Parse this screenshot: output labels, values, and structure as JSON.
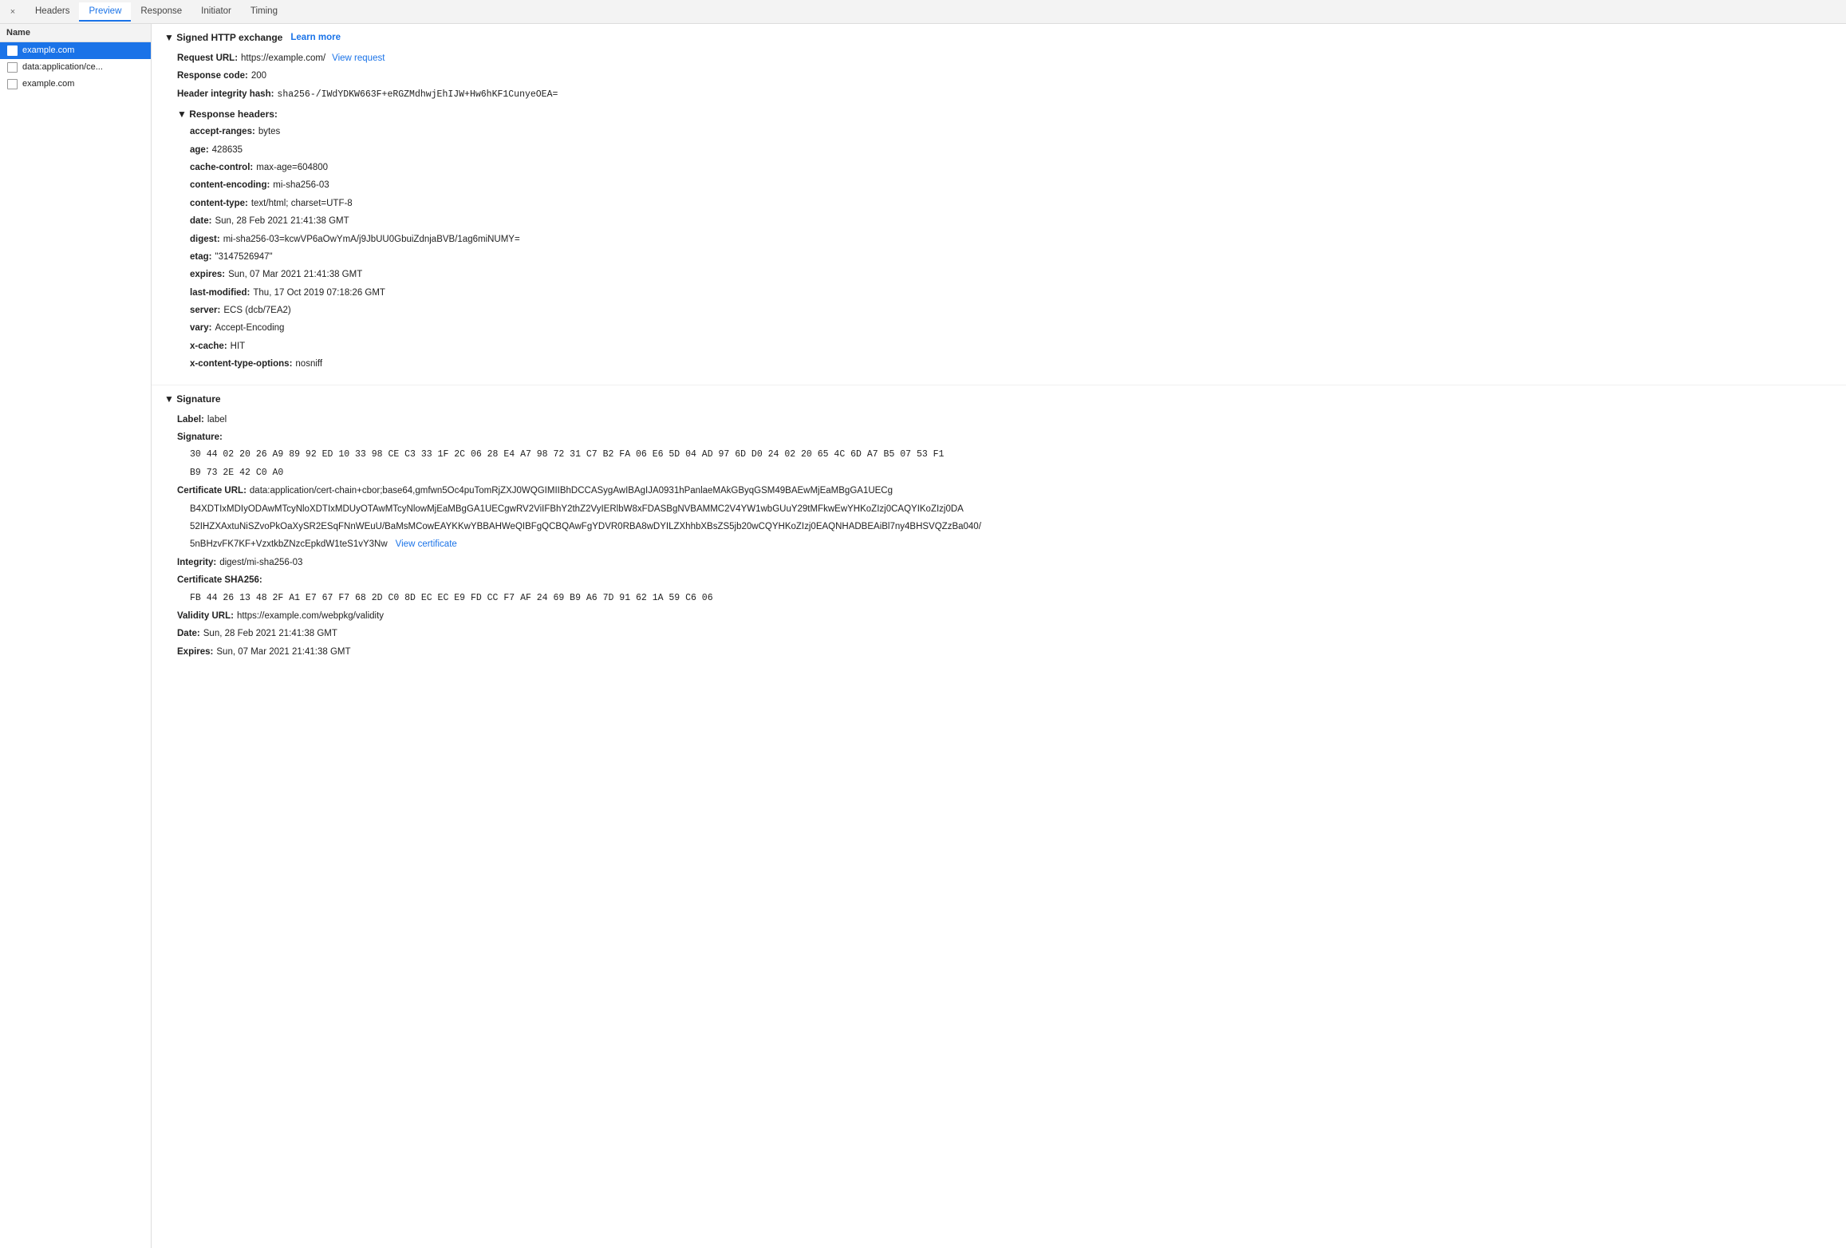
{
  "tabs": {
    "close_icon": "×",
    "items": [
      {
        "label": "Headers",
        "active": false
      },
      {
        "label": "Preview",
        "active": true
      },
      {
        "label": "Response",
        "active": false
      },
      {
        "label": "Initiator",
        "active": false
      },
      {
        "label": "Timing",
        "active": false
      }
    ]
  },
  "sidebar": {
    "header": "Name",
    "items": [
      {
        "label": "example.com",
        "selected": true
      },
      {
        "label": "data:application/ce...",
        "selected": false
      },
      {
        "label": "example.com",
        "selected": false
      }
    ]
  },
  "signed_exchange": {
    "section_title": "▼ Signed HTTP exchange",
    "learn_more": "Learn more",
    "request_url_label": "Request URL:",
    "request_url_value": "https://example.com/",
    "view_request": "View request",
    "response_code_label": "Response code:",
    "response_code_value": "200",
    "header_integrity_label": "Header integrity hash:",
    "header_integrity_value": "sha256-/IWdYDKW663F+eRGZMdhwjEhIJW+Hw6hKF1CunyeOEA=",
    "response_headers_title": "▼ Response headers:",
    "response_headers": [
      {
        "key": "accept-ranges:",
        "value": "bytes"
      },
      {
        "key": "age:",
        "value": "428635"
      },
      {
        "key": "cache-control:",
        "value": "max-age=604800"
      },
      {
        "key": "content-encoding:",
        "value": "mi-sha256-03"
      },
      {
        "key": "content-type:",
        "value": "text/html; charset=UTF-8"
      },
      {
        "key": "date:",
        "value": "Sun, 28 Feb 2021 21:41:38 GMT"
      },
      {
        "key": "digest:",
        "value": "mi-sha256-03=kcwVP6aOwYmA/j9JbUU0GbuiZdnjaBVB/1ag6miNUMY="
      },
      {
        "key": "etag:",
        "value": "\"3147526947\""
      },
      {
        "key": "expires:",
        "value": "Sun, 07 Mar 2021 21:41:38 GMT"
      },
      {
        "key": "last-modified:",
        "value": "Thu, 17 Oct 2019 07:18:26 GMT"
      },
      {
        "key": "server:",
        "value": "ECS (dcb/7EA2)"
      },
      {
        "key": "vary:",
        "value": "Accept-Encoding"
      },
      {
        "key": "x-cache:",
        "value": "HIT"
      },
      {
        "key": "x-content-type-options:",
        "value": "nosniff"
      }
    ]
  },
  "signature": {
    "section_title": "▼ Signature",
    "label_key": "Label:",
    "label_value": "label",
    "signature_key": "Signature:",
    "signature_line1": "30 44 02 20 26 A9 89 92 ED 10 33 98 CE C3 33 1F 2C 06 28 E4 A7 98 72 31 C7 B2 FA 06 E6 5D 04 AD 97 6D D0 24 02 20 65 4C 6D A7 B5 07 53 F1",
    "signature_line2": "B9 73 2E 42 C0 A0",
    "cert_url_key": "Certificate URL:",
    "cert_url_value": "data:application/cert-chain+cbor;base64,gmfwn5Oc4puTomRjZXJ0WQGIMIIBhDCCASygAwIBAgIJA0931hPanlaeMAkGByqGSM49BAEwMjEaMBgGA1UECg",
    "cert_url_line2": "B4XDTIxMDIyODAwMTcyNloXDTIxMDUyOTAwMTcyNlowMjEaMBgGA1UECgwRV2ViIFBhY2thZ2VyIERlbW8xFDASBgNVBAMMC2V4YW1wbGUuY29tMFkwEwYHKoZIzj0CAQYIKoZIzj0DA",
    "cert_url_line3": "52IHZXAxtuNiSZvoPkOaXySR2ESqFNnWEuU/BaMsMCowEAYKKwYBBAHWeQIBFgQCBQAwFgYDVR0RBA8wDYILZXhhbXBsZS5jb20wCQYHKoZIzj0EAQNHADBEAiBl7ny4BHSVQZzBa040/",
    "cert_url_line4": "5nBHzvFK7KF+VzxtkbZNzcEpkdW1teS1vY3Nw",
    "view_certificate": "View certificate",
    "integrity_key": "Integrity:",
    "integrity_value": "digest/mi-sha256-03",
    "cert_sha256_key": "Certificate SHA256:",
    "cert_sha256_value": "FB 44 26 13 48 2F A1 E7 67 F7 68 2D C0 8D EC EC E9 FD CC F7 AF 24 69 B9 A6 7D 91 62 1A 59 C6 06",
    "validity_url_key": "Validity URL:",
    "validity_url_value": "https://example.com/webpkg/validity",
    "date_key": "Date:",
    "date_value": "Sun, 28 Feb 2021 21:41:38 GMT",
    "expires_key": "Expires:",
    "expires_value": "Sun, 07 Mar 2021 21:41:38 GMT"
  }
}
